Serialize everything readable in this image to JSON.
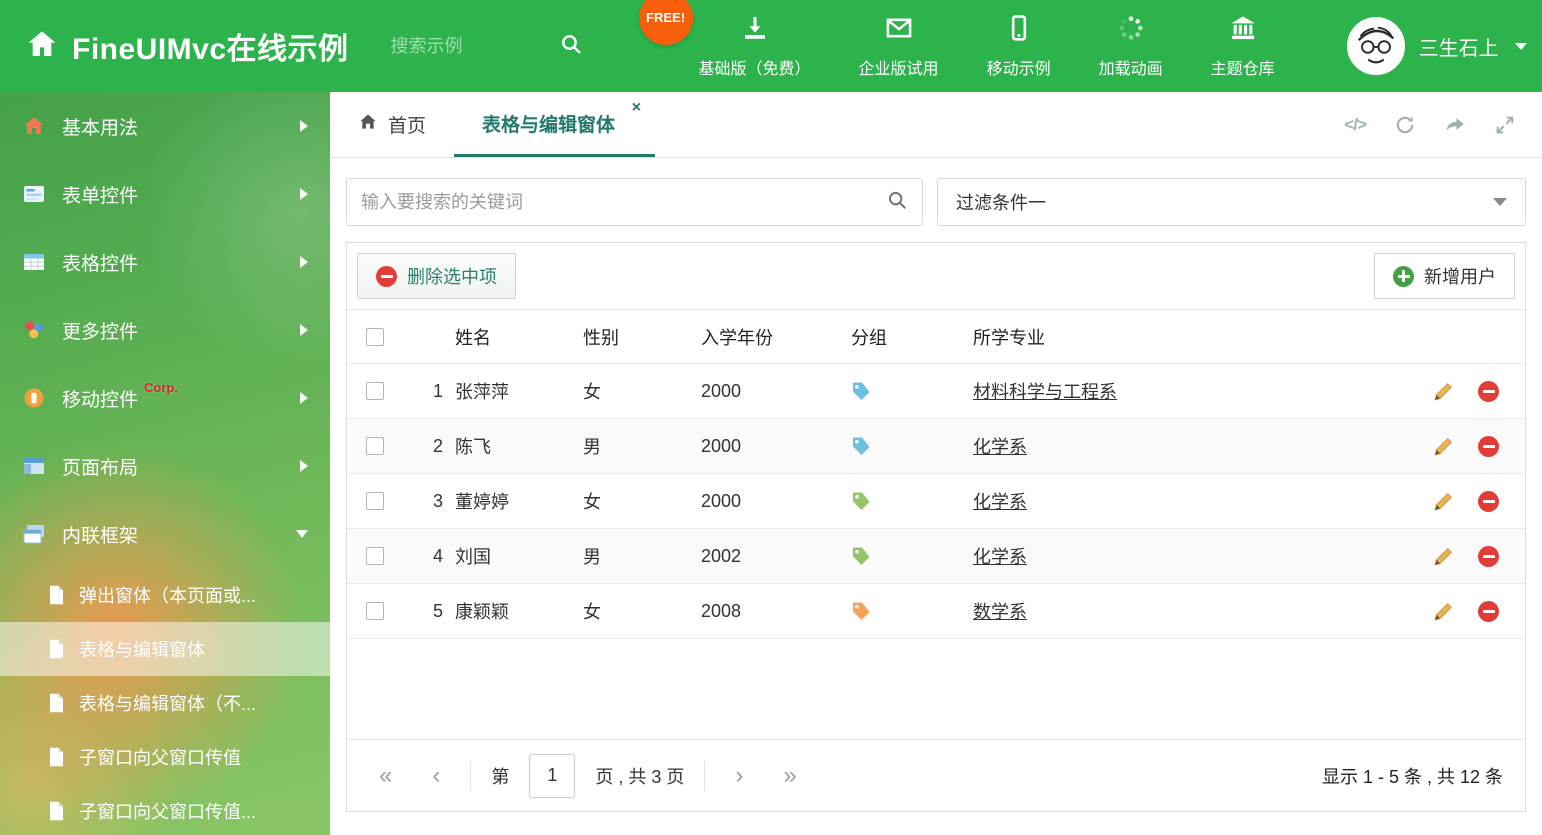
{
  "header": {
    "title": "FineUIMvc在线示例",
    "search_placeholder": "搜索示例",
    "free_badge": "FREE!",
    "nav_items": [
      {
        "label": "基础版（免费）"
      },
      {
        "label": "企业版试用"
      },
      {
        "label": "移动示例"
      },
      {
        "label": "加载动画"
      },
      {
        "label": "主题仓库"
      }
    ],
    "username": "三生石上"
  },
  "sidebar": {
    "items": [
      {
        "label": "基本用法"
      },
      {
        "label": "表单控件"
      },
      {
        "label": "表格控件"
      },
      {
        "label": "更多控件"
      },
      {
        "label": "移动控件",
        "badge": "Corp."
      },
      {
        "label": "页面布局"
      },
      {
        "label": "内联框架"
      }
    ],
    "subitems": [
      {
        "label": "弹出窗体（本页面或..."
      },
      {
        "label": "表格与编辑窗体"
      },
      {
        "label": "表格与编辑窗体（不..."
      },
      {
        "label": "子窗口向父窗口传值"
      },
      {
        "label": "子窗口向父窗口传值..."
      }
    ]
  },
  "tabs": {
    "home_label": "首页",
    "active_label": "表格与编辑窗体"
  },
  "filterbar": {
    "search_placeholder": "输入要搜索的关键词",
    "filter_value": "过滤条件一"
  },
  "toolbar": {
    "delete_label": "删除选中项",
    "add_label": "新增用户"
  },
  "table": {
    "columns": {
      "name": "姓名",
      "gender": "性别",
      "year": "入学年份",
      "group": "分组",
      "major": "所学专业"
    },
    "rows": [
      {
        "num": "1",
        "name": "张萍萍",
        "gender": "女",
        "year": "2000",
        "tag_color": "#6bbfdf",
        "major": "材料科学与工程系"
      },
      {
        "num": "2",
        "name": "陈飞",
        "gender": "男",
        "year": "2000",
        "tag_color": "#6bbfdf",
        "major": "化学系"
      },
      {
        "num": "3",
        "name": "董婷婷",
        "gender": "女",
        "year": "2000",
        "tag_color": "#96c569",
        "major": "化学系"
      },
      {
        "num": "4",
        "name": "刘国",
        "gender": "男",
        "year": "2002",
        "tag_color": "#96c569",
        "major": "化学系"
      },
      {
        "num": "5",
        "name": "康颖颖",
        "gender": "女",
        "year": "2008",
        "tag_color": "#f2a558",
        "major": "数学系"
      }
    ]
  },
  "pagination": {
    "prefix": "第",
    "page_value": "1",
    "suffix": "页 , 共 3 页",
    "summary": "显示 1 - 5 条 , 共 12 条"
  },
  "colors": {
    "header_green": "#2cb34b",
    "accent_teal": "#23796c",
    "free_badge_orange": "#f85f0c",
    "delete_red": "#e23c39",
    "add_green": "#3fa243",
    "pencil_gold": "#eab353"
  }
}
